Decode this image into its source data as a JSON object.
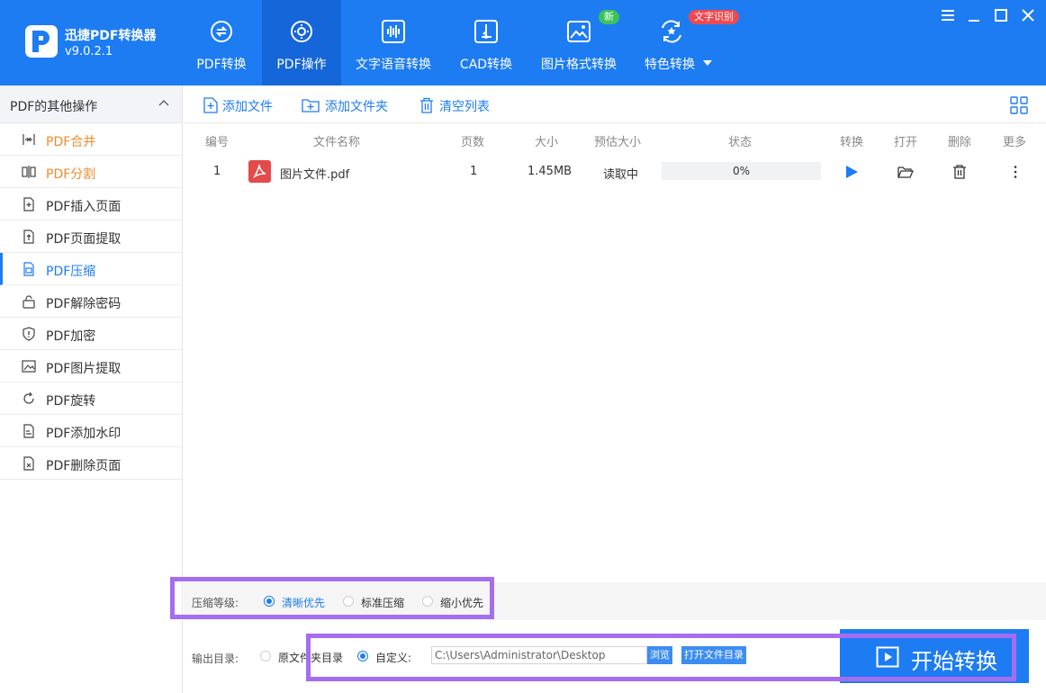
{
  "app": {
    "name": "迅捷PDF转换器",
    "version": "v9.0.2.1"
  },
  "nav": {
    "tabs": [
      {
        "label": "PDF转换",
        "icon": "pdf-convert-icon"
      },
      {
        "label": "PDF操作",
        "icon": "pdf-operate-icon",
        "active": true
      },
      {
        "label": "文字语音转换",
        "icon": "voice-wave-icon"
      },
      {
        "label": "CAD转换",
        "icon": "cad-icon"
      },
      {
        "label": "图片格式转换",
        "icon": "image-icon",
        "badge": "新"
      },
      {
        "label": "特色转换",
        "icon": "feature-convert-icon",
        "badge": "文字识别"
      }
    ]
  },
  "sidebar": {
    "header": "PDF的其他操作",
    "items": [
      {
        "label": "PDF合并",
        "color": "orange"
      },
      {
        "label": "PDF分割",
        "color": "orange"
      },
      {
        "label": "PDF插入页面"
      },
      {
        "label": "PDF页面提取"
      },
      {
        "label": "PDF压缩",
        "selected": true
      },
      {
        "label": "PDF解除密码"
      },
      {
        "label": "PDF加密"
      },
      {
        "label": "PDF图片提取"
      },
      {
        "label": "PDF旋转"
      },
      {
        "label": "PDF添加水印"
      },
      {
        "label": "PDF删除页面"
      }
    ]
  },
  "toolbar": {
    "add_file": "添加文件",
    "add_folder": "添加文件夹",
    "clear_list": "清空列表"
  },
  "table": {
    "headers": [
      "编号",
      "文件名称",
      "页数",
      "大小",
      "预估大小",
      "状态",
      "转换",
      "打开",
      "删除",
      "更多"
    ],
    "rows": [
      {
        "index": "1",
        "name": "图片文件.pdf",
        "pages": "1",
        "size": "1.45MB",
        "estimate": "读取中",
        "status": "0%",
        "progress": 0
      }
    ]
  },
  "compress": {
    "label": "压缩等级:",
    "options": [
      {
        "label": "清晰优先",
        "checked": true
      },
      {
        "label": "标准压缩",
        "checked": false
      },
      {
        "label": "缩小优先",
        "checked": false
      }
    ]
  },
  "output": {
    "label": "输出目录:",
    "original_dir": "原文件夹目录",
    "custom": "自定义:",
    "path": "C:\\Users\\Administrator\\Desktop",
    "browse": "浏览",
    "open_dir": "打开文件目录"
  },
  "start_button": "开始转换",
  "colors": {
    "primary": "#1d7cf2",
    "orange": "#f28a2b",
    "highlight": "#a56df0",
    "badge_green": "#3cc25a",
    "badge_red": "#f2484e"
  }
}
